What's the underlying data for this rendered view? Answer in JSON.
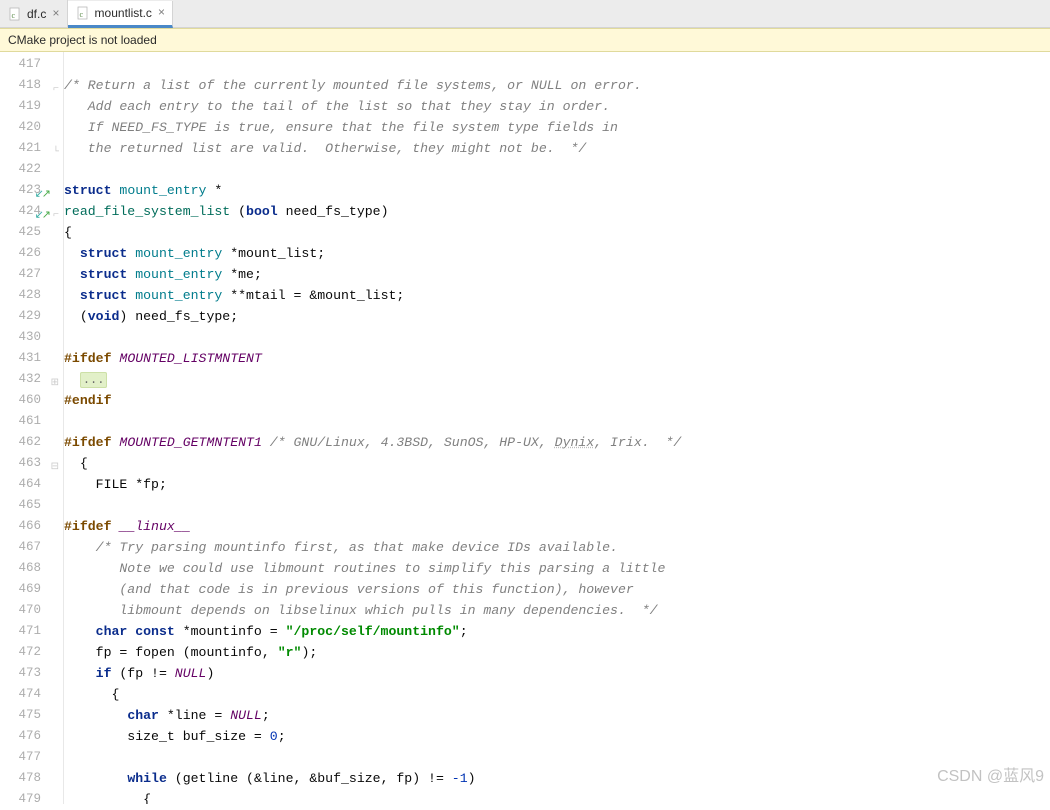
{
  "tabs": [
    {
      "label": "df.c",
      "active": false
    },
    {
      "label": "mountlist.c",
      "active": true
    }
  ],
  "notice": "CMake project is not loaded",
  "gutter": {
    "lines": [
      "417",
      "418",
      "419",
      "420",
      "421",
      "422",
      "423",
      "424",
      "425",
      "426",
      "427",
      "428",
      "429",
      "430",
      "431",
      "432",
      "460",
      "461",
      "462",
      "463",
      "464",
      "465",
      "466",
      "467",
      "468",
      "469",
      "470",
      "471",
      "472",
      "473",
      "474",
      "475",
      "476",
      "477",
      "478",
      "479"
    ],
    "vcs_marks": {
      "423": "sw",
      "424": "sw"
    },
    "fold_marks": {
      "418": "corner",
      "421": "end",
      "424": "corner",
      "432": "box",
      "463": "box"
    }
  },
  "code": {
    "l418_c": "/* Return a list of the currently mounted file systems, or NULL on error.",
    "l419_c": "   Add each entry to the tail of the list so that they stay in order.",
    "l420_c": "   If NEED_FS_TYPE is true, ensure that the file system type fields in",
    "l421_c": "   the returned list are valid.  Otherwise, they might not be.  */",
    "l423_kw": "struct",
    "l423_type": "mount_entry",
    "l423_rest": " *",
    "l424_func": "read_file_system_list",
    "l424_paren_open": " (",
    "l424_bool": "bool",
    "l424_arg": " need_fs_type)",
    "l425": "{",
    "l426_kw": "struct",
    "l426_type": "mount_entry",
    "l426_rest": " *mount_list;",
    "l427_kw": "struct",
    "l427_type": "mount_entry",
    "l427_rest": " *me;",
    "l428_kw": "struct",
    "l428_type": "mount_entry",
    "l428_rest": " **mtail = &mount_list;",
    "l429_open": "(",
    "l429_void": "void",
    "l429_rest": ") need_fs_type;",
    "l431_pre": "#ifdef ",
    "l431_id": "MOUNTED_LISTMNTENT",
    "l432_dots": "...",
    "l460_endif": "#endif",
    "l462_pre": "#ifdef ",
    "l462_id": "MOUNTED_GETMNTENT1",
    "l462_c": " /* GNU/Linux, 4.3BSD, SunOS, HP-UX, ",
    "l462_c_u": "Dynix",
    "l462_c2": ", Irix.  */",
    "l463": "  {",
    "l464_pre": "    FILE *",
    "l464_var": "fp;",
    "l466_pre": "#ifdef ",
    "l466_id": "__linux__",
    "l467_c": "    /* Try parsing mountinfo first, as that make device IDs available.",
    "l468_c": "       Note we could use libmount routines to simplify this parsing a little",
    "l469_c": "       (and that code is in previous versions of this function), however",
    "l470_c": "       libmount depends on libselinux which pulls in many dependencies.  */",
    "l471_kw1": "char const",
    "l471_mid": " *mountinfo = ",
    "l471_str": "\"/proc/self/mountinfo\"",
    "l471_end": ";",
    "l472_a": "    fp = fopen (mountinfo, ",
    "l472_str": "\"r\"",
    "l472_b": ");",
    "l473_if": "if",
    "l473_rest": " (fp != ",
    "l473_null": "NULL",
    "l473_end": ")",
    "l474": "      {",
    "l475_kw": "char",
    "l475_rest": " *line = ",
    "l475_null": "NULL",
    "l475_end": ";",
    "l476_a": "        size_t buf_size = ",
    "l476_num": "0",
    "l476_b": ";",
    "l478_while": "while",
    "l478_mid": " (getline (&line, &buf_size, fp) != ",
    "l478_neg1": "-1",
    "l478_end": ")",
    "l479": "          {"
  },
  "watermark": "CSDN @蓝风9"
}
